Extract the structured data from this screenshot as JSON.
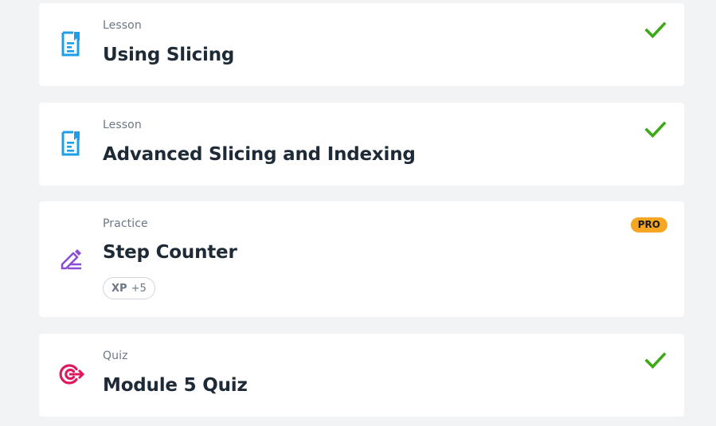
{
  "items": [
    {
      "kind": "Lesson",
      "title": "Using Slicing",
      "icon": "lesson-document-icon",
      "status": "completed",
      "status_icon": "checkmark-icon"
    },
    {
      "kind": "Lesson",
      "title": "Advanced Slicing and Indexing",
      "icon": "lesson-document-icon",
      "status": "completed",
      "status_icon": "checkmark-icon"
    },
    {
      "kind": "Practice",
      "title": "Step Counter",
      "icon": "practice-pencil-icon",
      "badge": "PRO",
      "xp_label": "XP",
      "xp_value": "+5"
    },
    {
      "kind": "Quiz",
      "title": "Module 5 Quiz",
      "icon": "quiz-target-icon",
      "status": "completed",
      "status_icon": "checkmark-icon"
    }
  ],
  "colors": {
    "background": "#f1f3f5",
    "lesson_icon": "#1e9ee6",
    "practice_icon": "#8a4fd6",
    "quiz_icon": "#e0195f",
    "check": "#3ea817",
    "pro_badge": "#f5a623"
  }
}
